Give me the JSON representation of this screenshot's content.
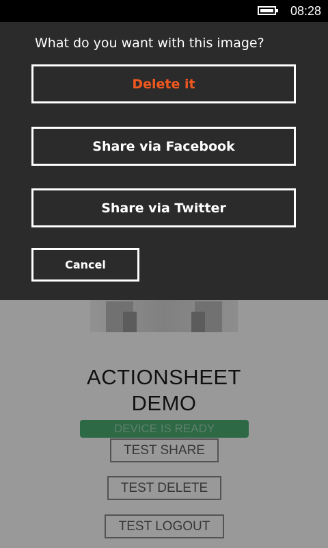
{
  "status_bar": {
    "time": "08:28",
    "battery_icon": "battery-full-icon"
  },
  "app": {
    "title_line1": "ACTIONSHEET",
    "title_line2": "DEMO",
    "status_badge": "DEVICE IS READY",
    "buttons": {
      "share": "TEST SHARE",
      "delete": "TEST DELETE",
      "logout": "TEST LOGOUT"
    },
    "logo_icon": "robot-logo-icon"
  },
  "action_sheet": {
    "title": "What do you want with this image?",
    "delete_label": "Delete it",
    "facebook_label": "Share via Facebook",
    "twitter_label": "Share via Twitter",
    "cancel_label": "Cancel"
  },
  "colors": {
    "sheet_background": "#2b2b2b",
    "destructive": "#f0581f",
    "badge": "#4caf74",
    "overlay": "rgba(0,0,0,0.40)"
  }
}
